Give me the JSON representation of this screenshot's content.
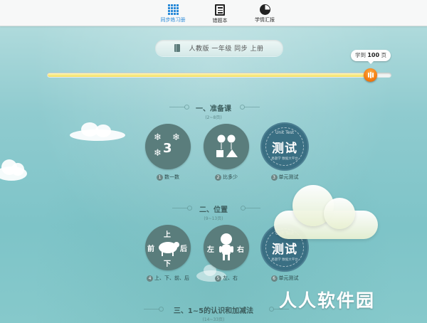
{
  "nav": {
    "tabs": [
      {
        "label": "同步练习册",
        "icon": "grid-icon",
        "active": true
      },
      {
        "label": "错题本",
        "icon": "checklist-icon",
        "active": false
      },
      {
        "label": "学情汇报",
        "icon": "pie-chart-icon",
        "active": false
      }
    ],
    "accent_color": "#2a8ad8"
  },
  "book": {
    "icon": "book-icon",
    "title": "人教版 一年级 同步 上册"
  },
  "progress": {
    "prefix": "学到",
    "page": "100",
    "suffix": "页",
    "fraction": 0.94,
    "knob_color": "#f47d12"
  },
  "sections": [
    {
      "title": "一、准备课",
      "range": "(2~8页)",
      "lessons": [
        {
          "num": "1",
          "label": "数一数",
          "art": "snowflake-three"
        },
        {
          "num": "2",
          "label": "比多少",
          "art": "shapes"
        },
        {
          "num": "3",
          "label": "单元测试",
          "art": "unit-test",
          "test_en": "Unit Test",
          "test_zh": "测试",
          "test_sub": "易题学 数据大平台"
        }
      ]
    },
    {
      "title": "二、位置",
      "range": "(9~13页)",
      "lessons": [
        {
          "num": "4",
          "label": "上、下、前、后",
          "art": "sheep",
          "glyphs": [
            "上",
            "下",
            "前",
            "后"
          ]
        },
        {
          "num": "5",
          "label": "左、右",
          "art": "child",
          "glyphs": [
            "左",
            "右"
          ]
        },
        {
          "num": "6",
          "label": "单元测试",
          "art": "unit-test",
          "test_en": "Unit Test",
          "test_zh": "测试",
          "test_sub": "易题学 数据大平台"
        }
      ]
    },
    {
      "title": "三、1~5的认识和加减法",
      "range": "(14~33页)",
      "lessons": []
    }
  ],
  "snow_digit": "3",
  "watermark": "人人软件园"
}
